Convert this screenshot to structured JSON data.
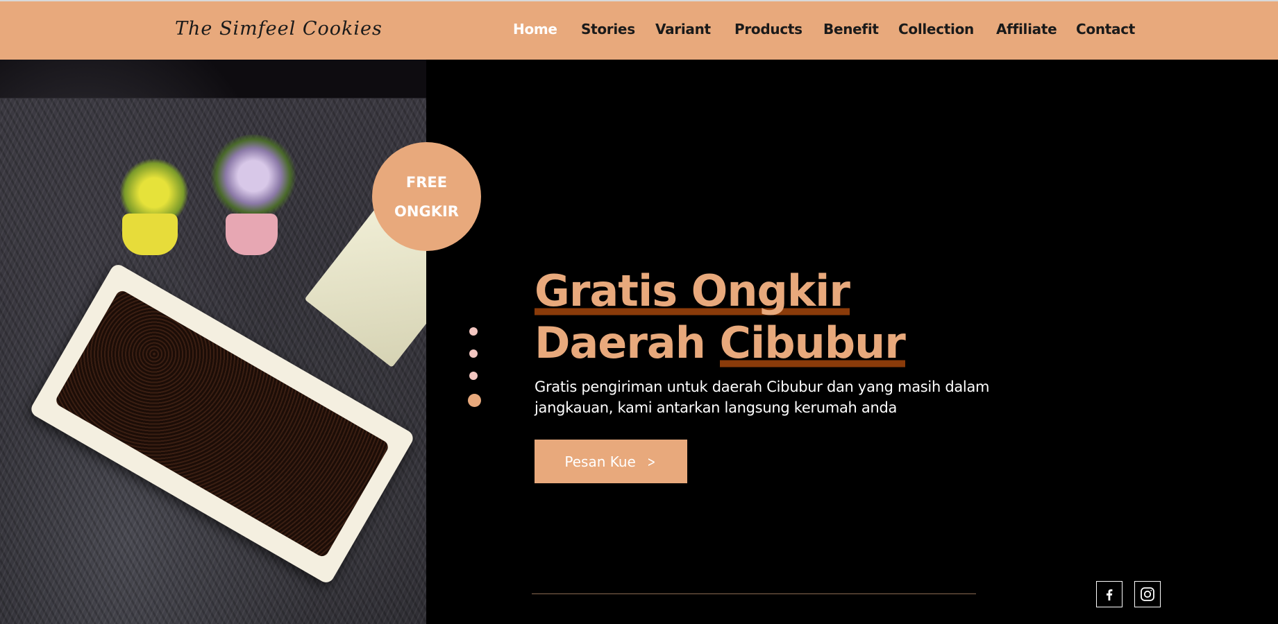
{
  "header": {
    "logo": "The Simfeel Cookies",
    "nav": [
      {
        "label": "Home",
        "active": true
      },
      {
        "label": "Stories",
        "active": false
      },
      {
        "label": "Variant",
        "active": false
      },
      {
        "label": "Products",
        "active": false
      },
      {
        "label": "Benefit",
        "active": false
      },
      {
        "label": "Collection",
        "active": false
      },
      {
        "label": "Affiliate",
        "active": false
      },
      {
        "label": "Contact",
        "active": false
      }
    ]
  },
  "badge": {
    "line1": "FREE",
    "line2": "ONGKIR"
  },
  "slider": {
    "count": 4,
    "active_index": 3
  },
  "hero": {
    "headline_highlight_1": "Gratis Ongkir",
    "headline_rest": " Daerah ",
    "headline_highlight_2": "Cibubur",
    "subtext": "Gratis pengiriman untuk daerah Cibubur dan yang masih dalam jangkauan, kami antarkan langsung kerumah anda",
    "cta_label": "Pesan Kue"
  },
  "social": [
    {
      "name": "facebook-icon"
    },
    {
      "name": "instagram-icon"
    }
  ],
  "colors": {
    "accent": "#e8a97c",
    "underline": "#8a3b0a",
    "background": "#000000"
  }
}
